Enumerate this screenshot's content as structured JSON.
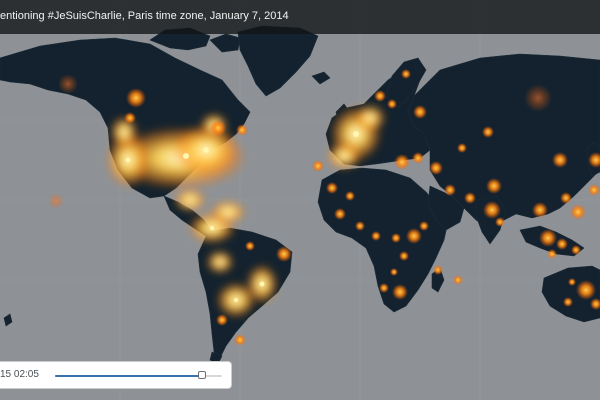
{
  "header": {
    "title": "entioning #JeSuisCharlie, Paris time zone, January 7, 2014"
  },
  "timeline": {
    "time_label": "15 02:05",
    "progress": 0.88
  },
  "colors": {
    "ocean": "#8e9296",
    "land": "#13222e",
    "glow_core": "#fff4a0",
    "glow_mid": "#ffb23a",
    "glow_outer": "#ff6a00"
  }
}
